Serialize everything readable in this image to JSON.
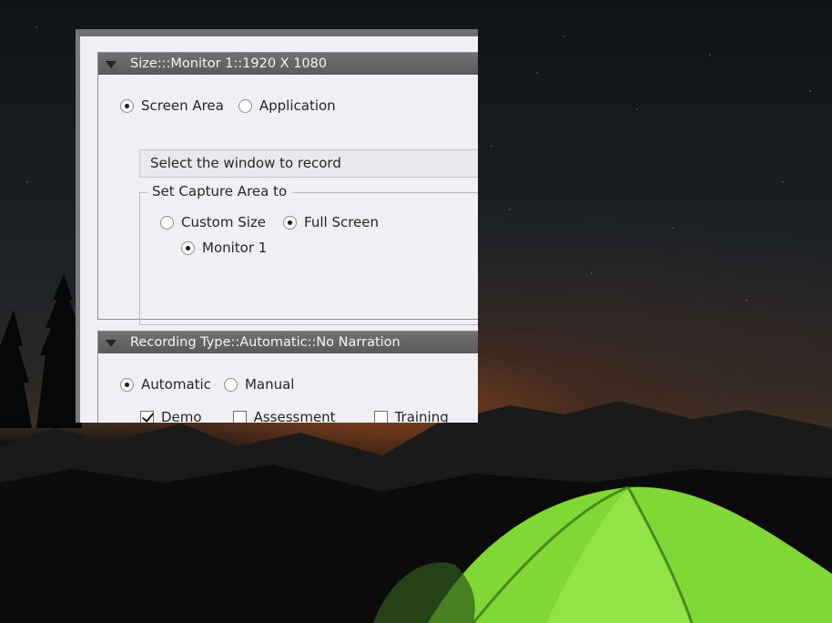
{
  "size_section": {
    "header": "Size:::Monitor 1::1920 X 1080",
    "capture_mode": {
      "options": [
        "Screen Area",
        "Application"
      ],
      "selected": "Screen Area"
    },
    "window_select": {
      "value": "Select the window to record"
    },
    "capture_area": {
      "legend": "Set Capture Area to",
      "options": [
        "Custom Size",
        "Full Screen"
      ],
      "selected": "Full Screen",
      "monitor_options": [
        "Monitor 1"
      ],
      "monitor_selected": "Monitor 1"
    }
  },
  "recording_section": {
    "header": "Recording Type::Automatic::No Narration",
    "mode": {
      "options": [
        "Automatic",
        "Manual"
      ],
      "selected": "Automatic"
    },
    "types": [
      {
        "label": "Demo",
        "checked": true
      },
      {
        "label": "Assessment",
        "checked": false
      },
      {
        "label": "Training",
        "checked": false
      }
    ]
  },
  "colors": {
    "header_bg": "#5f5f5f",
    "panel_bg": "#f0f0f4",
    "tent_green": "#8ee03a"
  },
  "icons": {
    "collapse": "triangle-down-icon"
  }
}
